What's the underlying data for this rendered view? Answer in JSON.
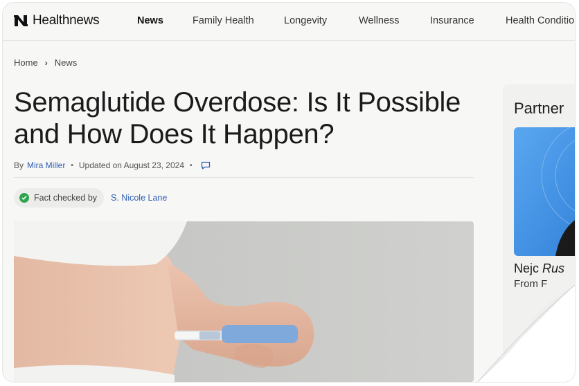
{
  "brand": {
    "name": "Healthnews",
    "logo_icon": "healthnews-logo-icon"
  },
  "nav": {
    "items": [
      {
        "label": "News",
        "active": true
      },
      {
        "label": "Family Health",
        "active": false
      },
      {
        "label": "Longevity",
        "active": false
      },
      {
        "label": "Wellness",
        "active": false
      },
      {
        "label": "Insurance",
        "active": false
      },
      {
        "label": "Health Conditio",
        "active": false
      }
    ]
  },
  "breadcrumb": {
    "home": "Home",
    "current": "News"
  },
  "article": {
    "title": "Semaglutide Overdose: Is It Possible and How Does It Happen?",
    "by": "By",
    "author": "Mira Miller",
    "updated": "Updated on August 23, 2024",
    "fact_checked_label": "Fact checked by",
    "fact_checker": "S. Nicole Lane"
  },
  "sidebar": {
    "title": "Partner",
    "name_first": "Nejc",
    "name_rest": "Rus",
    "sub": "From F"
  },
  "colors": {
    "link": "#2f5fb3",
    "check": "#2ea44f",
    "background": "#f7f7f6"
  }
}
